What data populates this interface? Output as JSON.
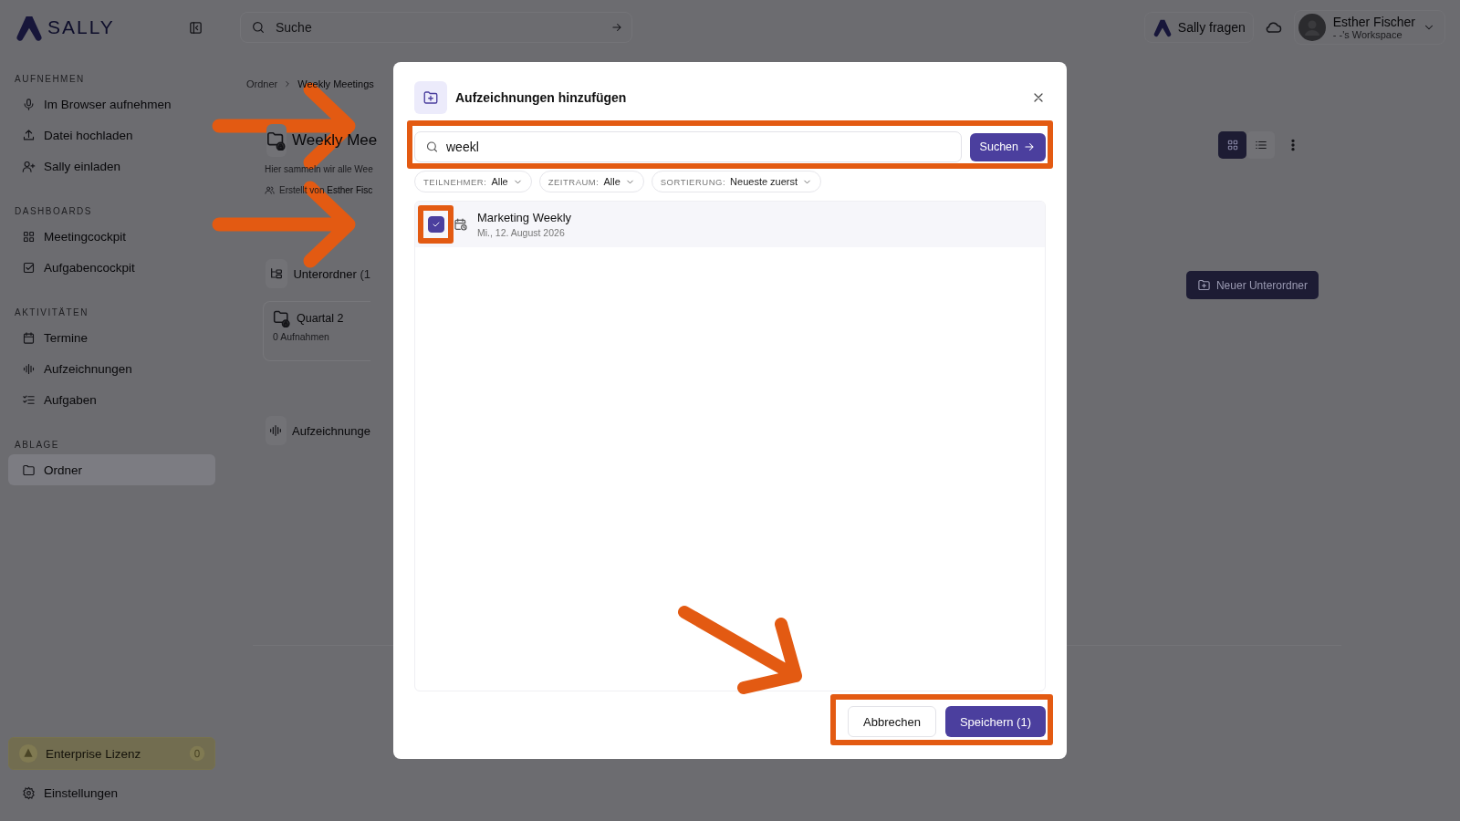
{
  "topbar": {
    "logo": "SALLY",
    "search": {
      "placeholder": "Suche"
    },
    "ask_button": "Sally fragen",
    "user": {
      "name": "Esther Fischer",
      "workspace": "- -'s Workspace"
    }
  },
  "sidebar": {
    "sections": [
      {
        "title": "AUFNEHMEN",
        "items": [
          {
            "label": "Im Browser aufnehmen",
            "selected": false
          },
          {
            "label": "Datei hochladen",
            "selected": false
          },
          {
            "label": "Sally einladen",
            "selected": false
          }
        ]
      },
      {
        "title": "DASHBOARDS",
        "items": [
          {
            "label": "Meetingcockpit",
            "selected": false
          },
          {
            "label": "Aufgabencockpit",
            "selected": false
          }
        ]
      },
      {
        "title": "AKTIVITÄTEN",
        "items": [
          {
            "label": "Termine",
            "selected": false
          },
          {
            "label": "Aufzeichnungen",
            "selected": false
          },
          {
            "label": "Aufgaben",
            "selected": false
          }
        ]
      },
      {
        "title": "ABLAGE",
        "items": [
          {
            "label": "Ordner",
            "selected": true
          }
        ]
      }
    ],
    "license": "Enterprise Lizenz",
    "settings": "Einstellungen"
  },
  "page": {
    "breadcrumb": [
      {
        "label": "Ordner"
      },
      {
        "label": "Weekly Meetings"
      }
    ],
    "title": "Weekly Mee",
    "description": "Hier sammeln wir alle Wee",
    "created_label": "Erstellt von",
    "created_by": "Esther Fisc",
    "subfolders_title": "Unterordner",
    "subfolders_count": "(1",
    "folders": [
      {
        "name": "Quartal 2",
        "count": "0 Aufnahmen"
      }
    ],
    "recordings_title": "Aufzeichnunge",
    "view_modes": [
      {
        "selected": true
      },
      {
        "selected": false
      }
    ],
    "new_subfolder_button": "Neuer Unterordner"
  },
  "dialog": {
    "title": "Aufzeichnungen hinzufügen",
    "search": {
      "value": "weekl"
    },
    "search_button": "Suchen",
    "filters": [
      {
        "label": "TEILNEHMER:",
        "value": "Alle"
      },
      {
        "label": "ZEITRAUM:",
        "value": "Alle"
      },
      {
        "label": "SORTIERUNG:",
        "value": "Neueste zuerst"
      }
    ],
    "results": [
      {
        "title": "Marketing Weekly",
        "date": "Mi., 12. August 2026",
        "checked": true
      }
    ],
    "cancel_button": "Abbrechen",
    "save_button": "Speichern (1)"
  }
}
